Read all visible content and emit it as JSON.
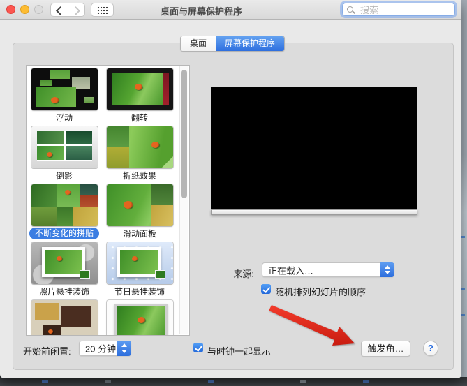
{
  "titlebar": {
    "title": "桌面与屏幕保护程序",
    "search_placeholder": "搜索"
  },
  "tabs": [
    {
      "label": "桌面",
      "selected": false
    },
    {
      "label": "屏幕保护程序",
      "selected": true
    }
  ],
  "savers": {
    "items": [
      {
        "label": "浮动",
        "style": "floating",
        "selected": false
      },
      {
        "label": "翻转",
        "style": "flip",
        "selected": false
      },
      {
        "label": "倒影",
        "style": "reflections",
        "selected": false
      },
      {
        "label": "折纸效果",
        "style": "origami",
        "selected": false
      },
      {
        "label": "不断变化的拼贴",
        "style": "tiles",
        "selected": true
      },
      {
        "label": "滑动面板",
        "style": "panels",
        "selected": false
      },
      {
        "label": "照片悬挂装饰",
        "style": "photo-mobile",
        "selected": false
      },
      {
        "label": "节日悬挂装饰",
        "style": "holiday-mobile",
        "selected": false
      },
      {
        "label": "",
        "style": "gallery",
        "selected": false
      },
      {
        "label": "",
        "style": "big-frame",
        "selected": false
      }
    ]
  },
  "preview": {
    "source_label": "来源:",
    "source_value": "正在载入…",
    "shuffle_label": "随机排列幻灯片的顺序",
    "shuffle_checked": true
  },
  "bottom": {
    "idle_label": "开始前闲置:",
    "idle_value": "20 分钟",
    "clock_label": "与时钟一起显示",
    "clock_checked": true,
    "hot_corners_label": "触发角…",
    "help_label": "?"
  },
  "colors": {
    "accent": "#3b7de2",
    "selected_tab": "#2e6fdf",
    "arrow_red": "#e02417"
  }
}
